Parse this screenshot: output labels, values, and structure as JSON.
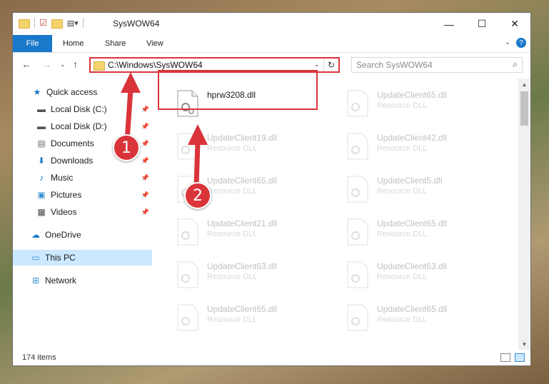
{
  "window": {
    "title": "SysWOW64"
  },
  "controls": {
    "minimize": "—",
    "maximize": "☐",
    "close": "✕"
  },
  "ribbon": {
    "file": "File",
    "home": "Home",
    "share": "Share",
    "view": "View",
    "help": "?"
  },
  "address": {
    "path": "C:\\Windows\\SysWOW64"
  },
  "search": {
    "placeholder": "Search SysWOW64"
  },
  "nav": {
    "quick_access": "Quick access",
    "local_c": "Local Disk (C:)",
    "local_d": "Local Disk (D:)",
    "documents": "Documents",
    "downloads": "Downloads",
    "music": "Music",
    "pictures": "Pictures",
    "videos": "Videos",
    "onedrive": "OneDrive",
    "thispc": "This PC",
    "network": "Network"
  },
  "files": [
    {
      "name": "hprw3208.dll",
      "type": ""
    },
    {
      "name": "UpdateClient65.dll",
      "type": "Resource DLL"
    },
    {
      "name": "UpdateClient19.dll",
      "type": "Resource DLL"
    },
    {
      "name": "UpdateClient42.dll",
      "type": "Resource DLL"
    },
    {
      "name": "UpdateClient65.dll",
      "type": "Resource DLL"
    },
    {
      "name": "UpdateClient5.dll",
      "type": "Resource DLL"
    },
    {
      "name": "UpdateClient21.dll",
      "type": "Resource DLL"
    },
    {
      "name": "UpdateClient65.dll",
      "type": "Resource DLL"
    },
    {
      "name": "UpdateClient63.dll",
      "type": "Resource DLL"
    },
    {
      "name": "UpdateClient63.dll",
      "type": "Resource DLL"
    },
    {
      "name": "UpdateClient65.dll",
      "type": "Resource DLL"
    },
    {
      "name": "UpdateClient65.dll",
      "type": "Resource DLL"
    }
  ],
  "status": {
    "count": "174 items"
  },
  "callouts": {
    "one": "1",
    "two": "2"
  },
  "colors": {
    "accent": "#1979ca",
    "callout": "#d9343a",
    "selection": "#cce8ff"
  }
}
